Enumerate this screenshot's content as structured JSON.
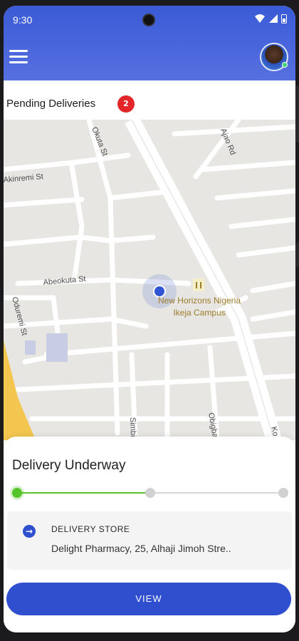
{
  "status": {
    "time": "9:30"
  },
  "header": {
    "menu_icon": "hamburger-menu-icon",
    "avatar": "user-avatar"
  },
  "pending": {
    "label": "Pending Deliveries",
    "count": "2"
  },
  "map": {
    "streets": [
      "Okuta St",
      "Ajao Rd",
      "Akinremi St",
      "Abeokuta St",
      "Oduremi St",
      "Simbi",
      "Obigba",
      "Ko"
    ],
    "place": {
      "name_line1": "New Horizons Nigeria",
      "name_line2": "Ikeja Campus"
    }
  },
  "delivery": {
    "title": "Delivery Underway",
    "progress_fraction": 0.5,
    "store_heading": "DELIVERY STORE",
    "store_address": "Delight Pharmacy, 25, Alhaji Jimoh Stre..",
    "view_label": "VIEW"
  },
  "colors": {
    "primary": "#2f4fce",
    "badge": "#e2262a",
    "progress": "#58c42c"
  }
}
